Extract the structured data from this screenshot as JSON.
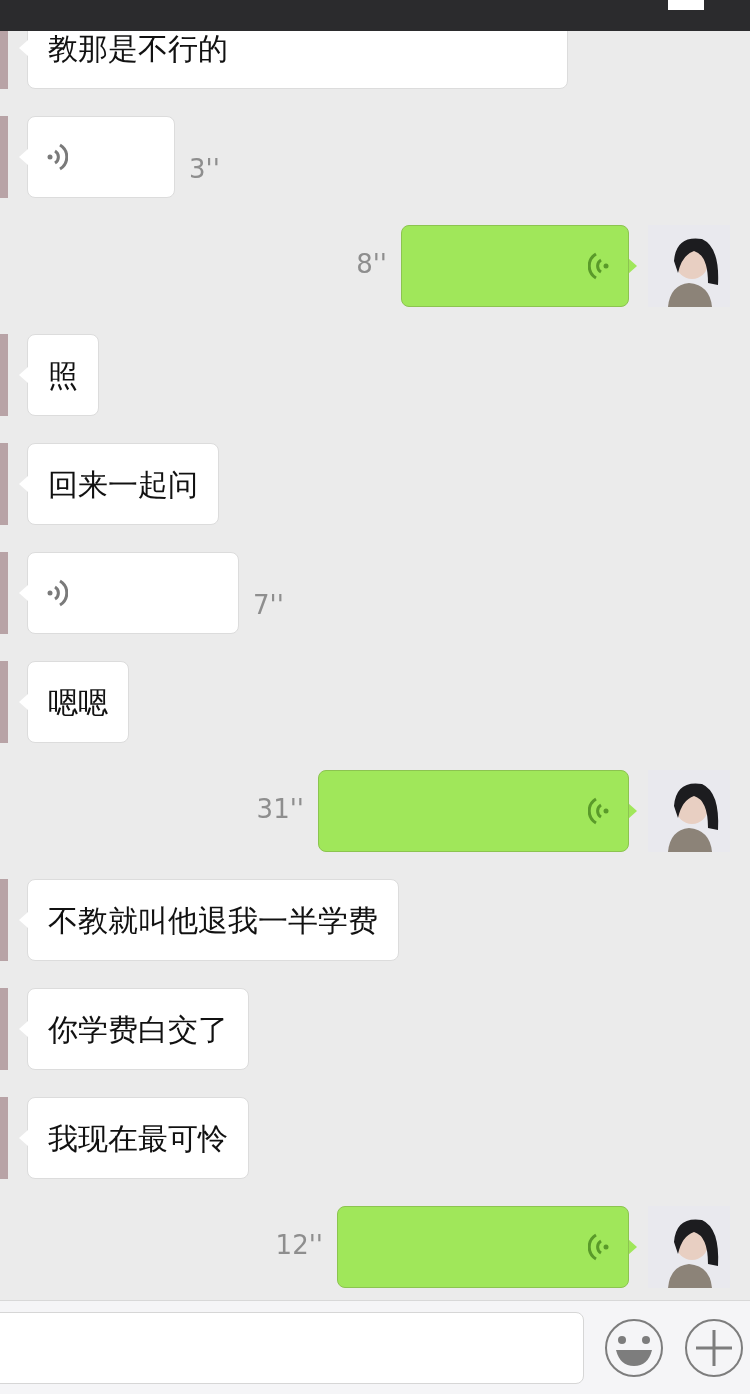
{
  "messages": [
    {
      "outgoing": false,
      "kind": "text",
      "text": "教那是不行的"
    },
    {
      "outgoing": false,
      "kind": "voice",
      "duration": "3''"
    },
    {
      "outgoing": true,
      "kind": "voice",
      "duration": "8''"
    },
    {
      "outgoing": false,
      "kind": "text",
      "text": "照"
    },
    {
      "outgoing": false,
      "kind": "text",
      "text": "回来一起问"
    },
    {
      "outgoing": false,
      "kind": "voice",
      "duration": "7''"
    },
    {
      "outgoing": false,
      "kind": "text",
      "text": "嗯嗯"
    },
    {
      "outgoing": true,
      "kind": "voice",
      "duration": "31''"
    },
    {
      "outgoing": false,
      "kind": "text",
      "text": "不教就叫他退我一半学费"
    },
    {
      "outgoing": false,
      "kind": "text",
      "text": "你学费白交了"
    },
    {
      "outgoing": false,
      "kind": "text",
      "text": "我现在最可怜"
    },
    {
      "outgoing": true,
      "kind": "voice",
      "duration": "12''"
    }
  ]
}
